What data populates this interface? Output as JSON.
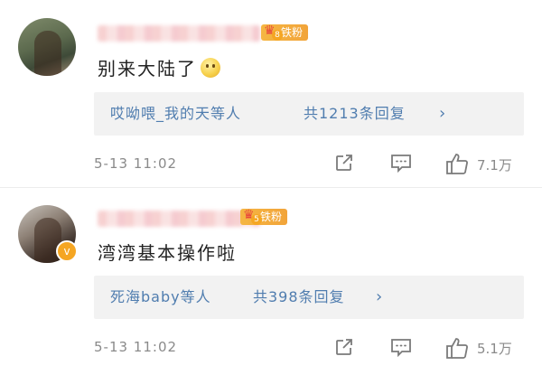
{
  "comments": [
    {
      "fan_badge": {
        "label": "铁粉",
        "level": "8"
      },
      "text": "别来大陆了",
      "emoji": "smile-emoji",
      "replies": {
        "who": "哎呦喂_我的天等人",
        "count": "共1213条回复",
        "chevron": "›"
      },
      "timestamp": "5-13 11:02",
      "likes": "7.1万"
    },
    {
      "fan_badge": {
        "label": "铁粉",
        "level": "5"
      },
      "verified": "v",
      "text": "湾湾基本操作啦",
      "replies": {
        "who": "死海baby等人",
        "count": "共398条回复",
        "chevron": "›"
      },
      "timestamp": "5-13 11:02",
      "likes": "5.1万"
    }
  ],
  "colors": {
    "link": "#507daf",
    "badge": "#f5a623",
    "meta": "#8a8a8a"
  }
}
